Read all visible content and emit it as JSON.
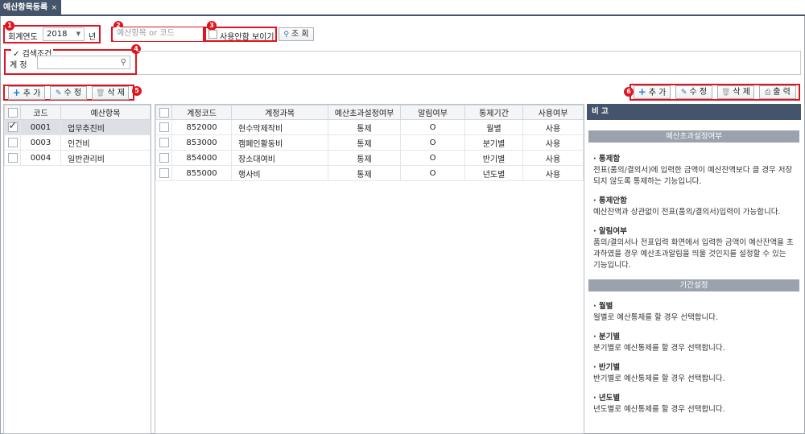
{
  "tab": {
    "title": "예산항목등록",
    "close": "×"
  },
  "markers": [
    "1",
    "2",
    "3",
    "4",
    "5",
    "6"
  ],
  "search": {
    "year_label": "회계연도",
    "year_value": "2018",
    "year_unit": "년",
    "keyword_placeholder": "예산항목 or 코드",
    "show_unused_label": "사용안함 보이기",
    "query_label": "조 회"
  },
  "filter": {
    "legend": "검색조건",
    "account_label": "계 정"
  },
  "left_toolbar": {
    "add": "추 가",
    "edit": "수 정",
    "delete": "삭 제"
  },
  "right_toolbar": {
    "add": "추 가",
    "edit": "수 정",
    "delete": "삭 제",
    "print": "출 력"
  },
  "left_grid": {
    "headers": [
      "코드",
      "예산항목"
    ],
    "rows": [
      {
        "code": "0001",
        "name": "업무추진비",
        "checked": true
      },
      {
        "code": "0003",
        "name": "인건비",
        "checked": false
      },
      {
        "code": "0004",
        "name": "일반관리비",
        "checked": false
      }
    ]
  },
  "main_grid": {
    "headers": [
      "계정코드",
      "계정과목",
      "예산초과설정여부",
      "알림여부",
      "통제기간",
      "사용여부"
    ],
    "rows": [
      {
        "code": "852000",
        "name": "현수막제작비",
        "over": "통제",
        "alert": "O",
        "period": "월별",
        "use": "사용"
      },
      {
        "code": "853000",
        "name": "캠페인활동비",
        "over": "통제",
        "alert": "O",
        "period": "분기별",
        "use": "사용"
      },
      {
        "code": "854000",
        "name": "장소대여비",
        "over": "통제",
        "alert": "O",
        "period": "반기별",
        "use": "사용"
      },
      {
        "code": "855000",
        "name": "행사비",
        "over": "통제",
        "alert": "O",
        "period": "년도별",
        "use": "사용"
      }
    ]
  },
  "note": {
    "title": "비 고",
    "section1": "예산초과설정여부",
    "items1": [
      {
        "title": "· 통제함",
        "text": "전표(품의/결의서)에 입력한 금액이 예산잔액보다 클 경우 저장되지 않도록 통제하는 기능입니다."
      },
      {
        "title": "· 통제안함",
        "text": "예산잔액과 상관없이 전표(품의/결의서)입력이 가능합니다."
      },
      {
        "title": "· 알림여부",
        "text": "품의/결의서나 전표입력 화면에서 입력한 금액이 예산잔액을 초과하였을 경우 예산초과알림을 띄울 것인지를 설정할 수 있는 기능입니다."
      }
    ],
    "section2": "기간설정",
    "items2": [
      {
        "title": "· 월별",
        "text": "월별로 예산통제를 할 경우 선택합니다."
      },
      {
        "title": "· 분기별",
        "text": "분기별로 예산통제를 할 경우 선택합니다."
      },
      {
        "title": "· 반기별",
        "text": "반기별로 예산통제를 할 경우 선택합니다."
      },
      {
        "title": "· 년도별",
        "text": "년도별로 예산통제를 할 경우 선택합니다."
      }
    ]
  }
}
